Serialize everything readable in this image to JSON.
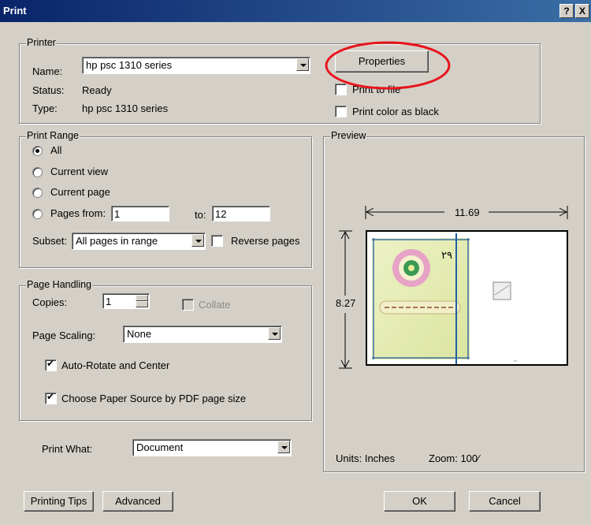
{
  "window": {
    "title": "Print",
    "help_label": "?",
    "close_label": "X"
  },
  "printer": {
    "legend": "Printer",
    "name_label": "Name:",
    "name_value": "hp psc 1310 series",
    "status_label": "Status:",
    "status_value": "Ready",
    "type_label": "Type:",
    "type_value": "hp psc 1310 series",
    "properties_label": "Properties",
    "print_to_file_label": "Print to file",
    "print_color_black_label": "Print color as black"
  },
  "print_range": {
    "legend": "Print Range",
    "all_label": "All",
    "current_view_label": "Current view",
    "current_page_label": "Current page",
    "pages_from_label": "Pages from:",
    "pages_from_value": "1",
    "to_label": "to:",
    "to_value": "12",
    "subset_label": "Subset:",
    "subset_value": "All pages in range",
    "reverse_label": "Reverse pages"
  },
  "page_handling": {
    "legend": "Page Handling",
    "copies_label": "Copies:",
    "copies_value": "1",
    "collate_label": "Collate",
    "scaling_label": "Page Scaling:",
    "scaling_value": "None",
    "auto_rotate_label": "Auto-Rotate and Center",
    "paper_source_label": "Choose Paper Source by PDF page size"
  },
  "print_what": {
    "label": "Print What:",
    "value": "Document"
  },
  "preview": {
    "legend": "Preview",
    "width_value": "11.69",
    "height_value": "8.27",
    "page_number": "۲۹",
    "units_label": "Units: Inches",
    "zoom_label": "Zoom: 100⁄"
  },
  "buttons": {
    "tips": "Printing Tips",
    "advanced": "Advanced",
    "ok": "OK",
    "cancel": "Cancel"
  },
  "colors": {
    "annotation": "#e8141c",
    "titlebar": "#0a246a"
  }
}
